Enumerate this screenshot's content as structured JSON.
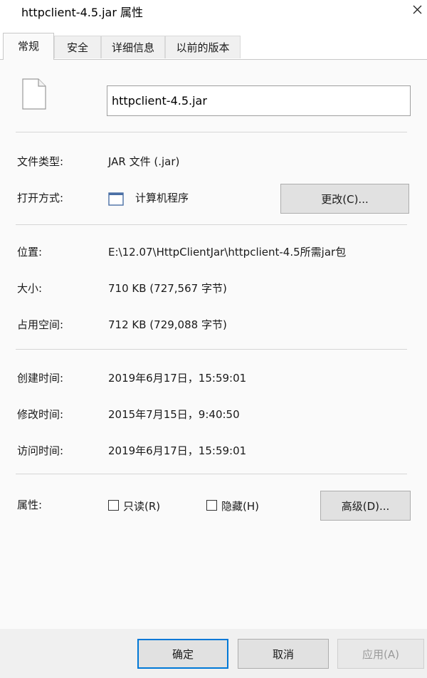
{
  "window": {
    "title": "httpclient-4.5.jar 属性"
  },
  "tabs": [
    {
      "label": "常规",
      "active": true
    },
    {
      "label": "安全",
      "active": false
    },
    {
      "label": "详细信息",
      "active": false
    },
    {
      "label": "以前的版本",
      "active": false
    }
  ],
  "file": {
    "name": "httpclient-4.5.jar"
  },
  "info": {
    "type_label": "文件类型:",
    "type_value": "JAR 文件 (.jar)",
    "openwith_label": "打开方式:",
    "openwith_value": "计算机程序",
    "change_button": "更改(C)...",
    "location_label": "位置:",
    "location_value": "E:\\12.07\\HttpClientJar\\httpclient-4.5所需jar包",
    "size_label": "大小:",
    "size_value": "710 KB (727,567 字节)",
    "disk_label": "占用空间:",
    "disk_value": "712 KB (729,088 字节)",
    "created_label": "创建时间:",
    "created_value": "2019年6月17日，15:59:01",
    "modified_label": "修改时间:",
    "modified_value": "2015年7月15日，9:40:50",
    "accessed_label": "访问时间:",
    "accessed_value": "2019年6月17日，15:59:01",
    "attributes_label": "属性:",
    "readonly_label": "只读(R)",
    "hidden_label": "隐藏(H)",
    "advanced_button": "高级(D)..."
  },
  "footer": {
    "ok": "确定",
    "cancel": "取消",
    "apply": "应用(A)"
  },
  "colors": {
    "accent": "#0078d7",
    "panel": "#fafafa",
    "button": "#e1e1e1"
  }
}
